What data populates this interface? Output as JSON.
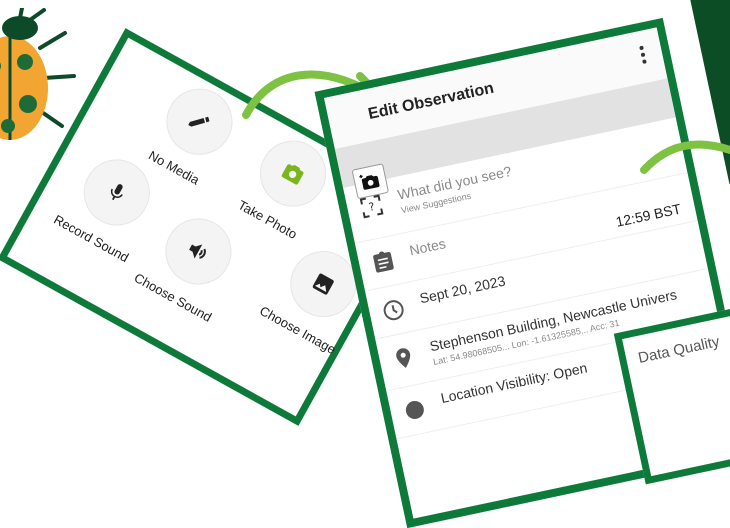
{
  "media_options": [
    {
      "key": "no_media",
      "label": "No Media"
    },
    {
      "key": "take_photo",
      "label": "Take Photo"
    },
    {
      "key": "choose_image",
      "label": "Choose Image"
    },
    {
      "key": "record_sound",
      "label": "Record Sound"
    },
    {
      "key": "choose_sound",
      "label": "Choose Sound"
    }
  ],
  "observation": {
    "title": "Edit Observation",
    "species_prompt": "What did you see?",
    "view_suggestions": "View Suggestions",
    "notes_placeholder": "Notes",
    "date": "Sept 20, 2023",
    "time": "12:59 BST",
    "location_name": "Stephenson Building, Newcastle Univers",
    "location_coords": "Lat: 54.98068505...  Lon: -1.61325585...  Acc: 31",
    "location_visibility": "Location Visibility: Open"
  },
  "data_quality": {
    "title": "Data Quality"
  },
  "colors": {
    "frame_green": "#0e7a3a",
    "arrow_green": "#7dc242",
    "camera_green": "#7ab51d",
    "dark_strip": "#0c4d26"
  },
  "icons": {
    "no_media": "pencil-icon",
    "take_photo": "camera-icon",
    "choose_image": "image-icon",
    "record_sound": "microphone-icon",
    "choose_sound": "speaker-icon"
  }
}
